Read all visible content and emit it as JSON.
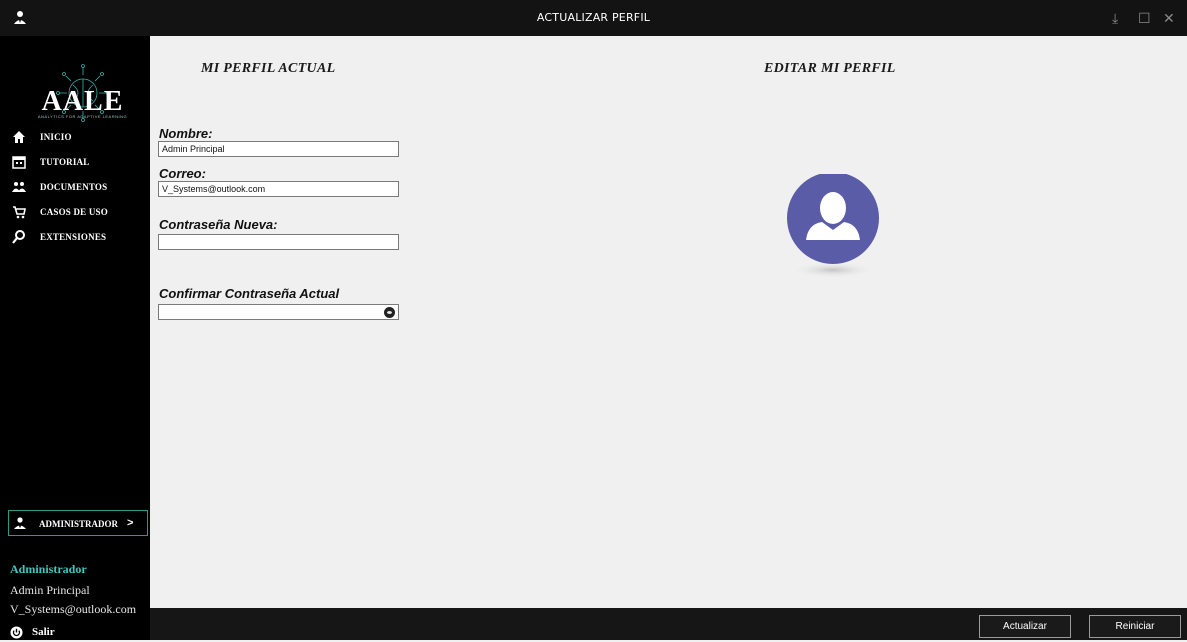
{
  "window": {
    "title": "ACTUALIZAR PERFIL",
    "app_icon": "user-tie-icon",
    "controls": {
      "download": "↓",
      "maximize": "☐",
      "close": "✕"
    }
  },
  "sidebar": {
    "logo_text": "AALE",
    "logo_subtitle": "ANALYTICS FOR ADAPTIVE LEARNING",
    "items": [
      {
        "label": "INICIO",
        "icon": "home-icon"
      },
      {
        "label": "TUTORIAL",
        "icon": "calendar-icon"
      },
      {
        "label": "DOCUMENTOS",
        "icon": "users-icon"
      },
      {
        "label": "CASOS DE USO",
        "icon": "cart-icon"
      },
      {
        "label": "EXTENSIONES",
        "icon": "search-icon"
      }
    ],
    "admin_button": {
      "label": "ADMINISTRADOR",
      "arrow": ">"
    },
    "user": {
      "role": "Administrador",
      "name": "Admin Principal",
      "email": "V_Systems@outlook.com"
    },
    "logout_label": "Salir"
  },
  "main": {
    "heading_current": "MI PERFIL ACTUAL",
    "heading_edit": "EDITAR MI PERFIL",
    "fields": {
      "name_label": "Nombre:",
      "name_value": "Admin Principal",
      "email_label": "Correo:",
      "email_value": "V_Systems@outlook.com",
      "new_password_label": "Contraseña Nueva:",
      "new_password_value": "",
      "confirm_password_label": "Confirmar Contraseña Actual",
      "confirm_password_value": ""
    }
  },
  "footer": {
    "update_label": "Actualizar",
    "reset_label": "Reiniciar"
  },
  "colors": {
    "accent": "#3ec7c0",
    "avatar": "#5b5ca8",
    "sidebar_bg": "#000000",
    "titlebar_bg": "#131313"
  }
}
